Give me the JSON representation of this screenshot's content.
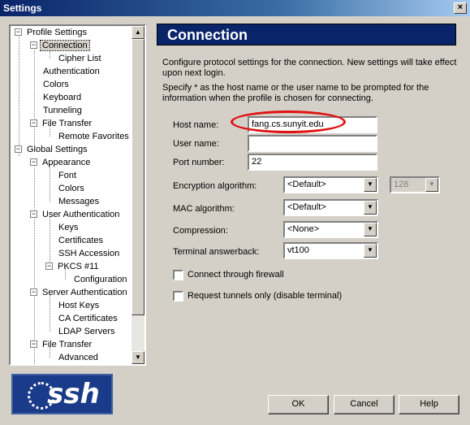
{
  "window": {
    "title": "Settings",
    "close_glyph": "×"
  },
  "tree": {
    "nodes": [
      {
        "label": "Profile Settings",
        "expander": "−"
      },
      {
        "label": "Connection",
        "expander": "−"
      },
      {
        "label": "Cipher List"
      },
      {
        "label": "Authentication"
      },
      {
        "label": "Colors"
      },
      {
        "label": "Keyboard"
      },
      {
        "label": "Tunneling"
      },
      {
        "label": "File Transfer",
        "expander": "−"
      },
      {
        "label": "Remote Favorites"
      },
      {
        "label": "Global Settings",
        "expander": "−"
      },
      {
        "label": "Appearance",
        "expander": "−"
      },
      {
        "label": "Font"
      },
      {
        "label": "Colors"
      },
      {
        "label": "Messages"
      },
      {
        "label": "User Authentication",
        "expander": "−"
      },
      {
        "label": "Keys"
      },
      {
        "label": "Certificates"
      },
      {
        "label": "SSH Accession"
      },
      {
        "label": "PKCS #11",
        "expander": "−"
      },
      {
        "label": "Configuration"
      },
      {
        "label": "Server Authentication",
        "expander": "−"
      },
      {
        "label": "Host Keys"
      },
      {
        "label": "CA Certificates"
      },
      {
        "label": "LDAP Servers"
      },
      {
        "label": "File Transfer",
        "expander": "−"
      },
      {
        "label": "Advanced"
      }
    ],
    "selected": "Connection",
    "scroll_up": "▲",
    "scroll_down": "▼"
  },
  "logo": {
    "text": "ssh"
  },
  "panel": {
    "title": "Connection",
    "description1": "Configure protocol settings for the connection. New settings will take effect upon next login.",
    "description2": "Specify * as the host name or the user name to be prompted for the information when the profile is chosen for connecting.",
    "host_name": {
      "label": "Host name:",
      "value": "fang.cs.sunyit.edu"
    },
    "user_name": {
      "label": "User name:",
      "value": ""
    },
    "port_number": {
      "label": "Port number:",
      "value": "22"
    },
    "encryption": {
      "label": "Encryption algorithm:",
      "value": "<Default>",
      "bits": "128"
    },
    "mac": {
      "label": "MAC algorithm:",
      "value": "<Default>"
    },
    "compression": {
      "label": "Compression:",
      "value": "<None>"
    },
    "answerback": {
      "label": "Terminal answerback:",
      "value": "vt100"
    },
    "firewall": {
      "label": "Connect through firewall",
      "checked": false
    },
    "tunnels_only": {
      "label": "Request tunnels only (disable terminal)",
      "checked": false
    },
    "drop_glyph": "▼",
    "highlight_color": "#e01010"
  },
  "buttons": {
    "ok": "OK",
    "cancel": "Cancel",
    "help": "Help"
  }
}
